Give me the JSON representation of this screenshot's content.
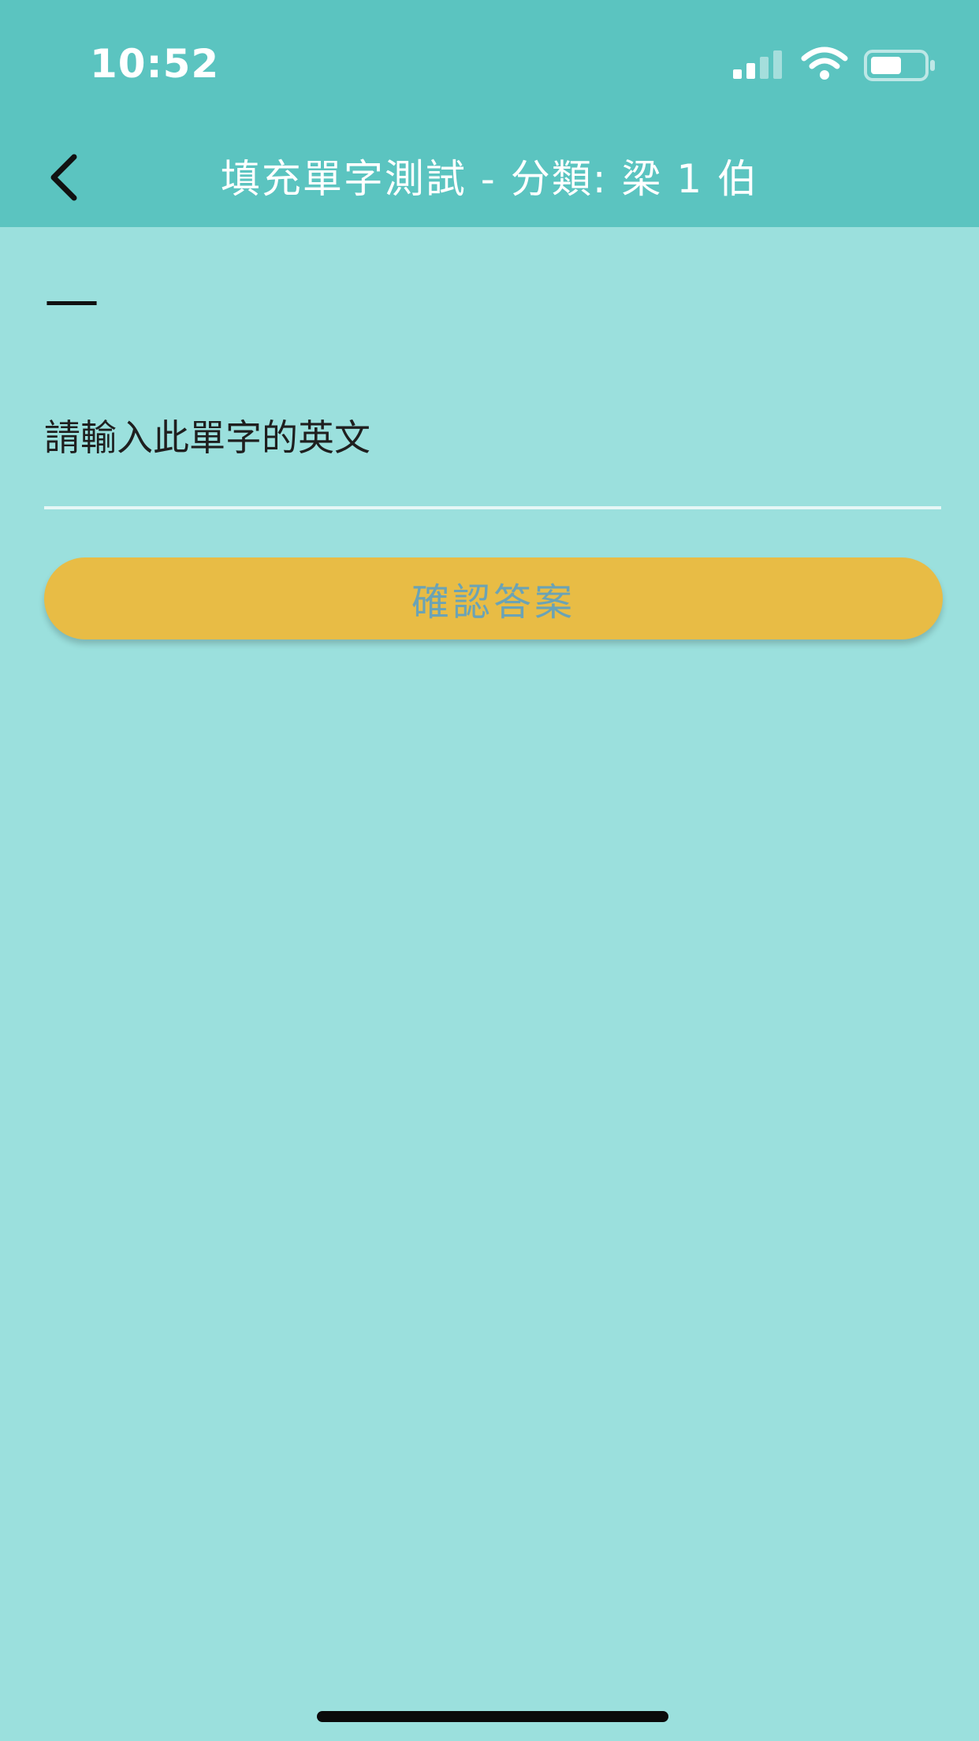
{
  "status_bar": {
    "time": "10:52"
  },
  "nav": {
    "title": "填充單字測試 - 分類: 梁 1 伯"
  },
  "quiz": {
    "word": "—",
    "answer_placeholder": "請輸入此單字的英文",
    "answer_value": "",
    "confirm_label": "確認答案"
  },
  "colors": {
    "header": "#5BC4C0",
    "background": "#9BE0DD",
    "button": "#E8BC45",
    "button_text": "#6BA3B5"
  },
  "icons": {
    "back": "chevron-left-icon",
    "signal": "cellular-signal-icon",
    "wifi": "wifi-icon",
    "battery": "battery-icon"
  }
}
